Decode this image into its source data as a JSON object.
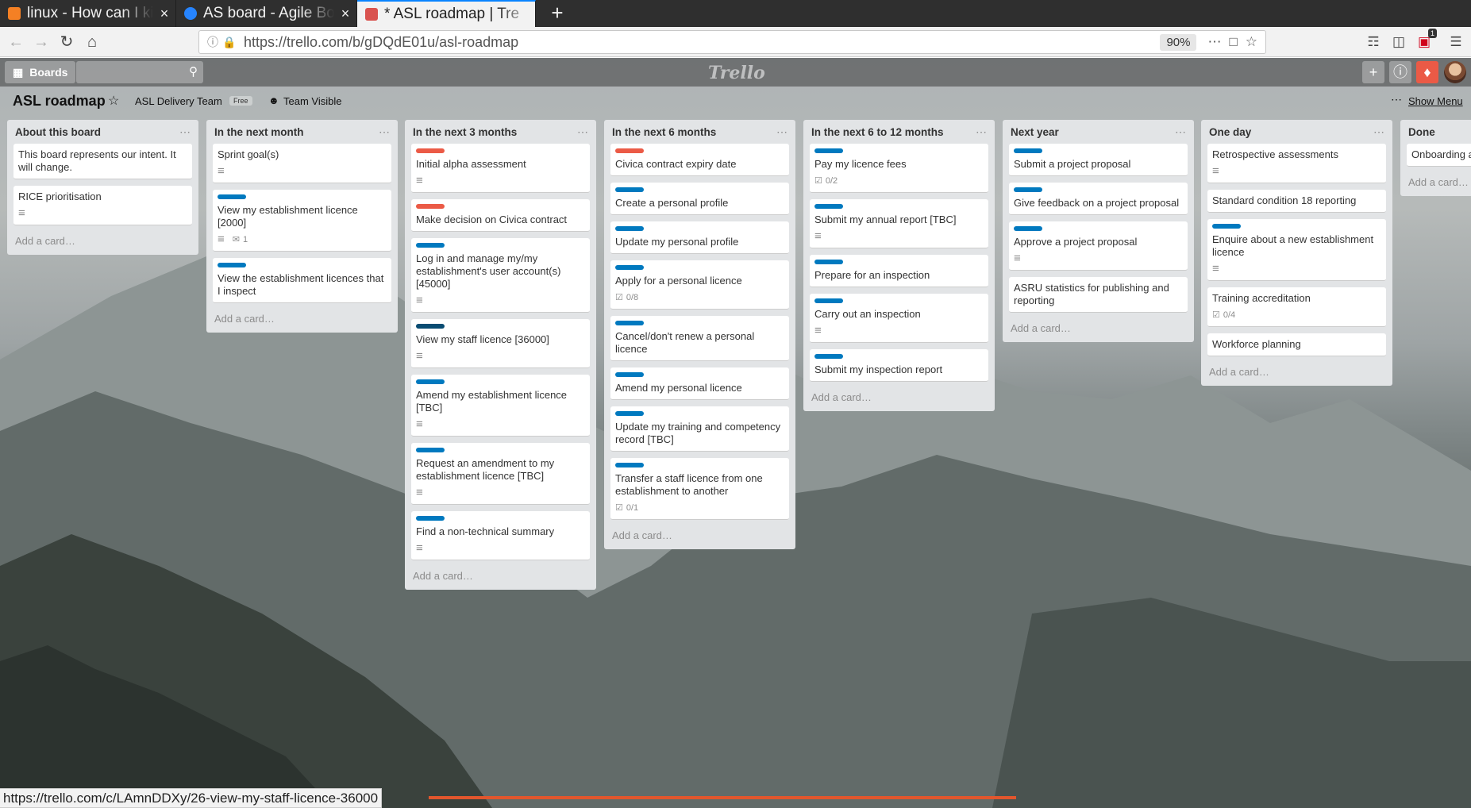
{
  "browser": {
    "tabs": [
      {
        "label": "linux - How can I kill",
        "favicon": "stackoverflow-icon",
        "active": false
      },
      {
        "label": "AS board - Agile Bo",
        "favicon": "jira-icon",
        "active": false
      },
      {
        "label": "* ASL roadmap | Tre",
        "favicon": "trello-icon",
        "active": true
      }
    ],
    "new_tab": "+",
    "close": "×",
    "url": "https://trello.com/b/gDQdE01u/asl-roadmap",
    "zoom": "90%",
    "notification_count": "1"
  },
  "trello": {
    "boards_label": "Boards",
    "logo": "Trello",
    "board_title": "ASL roadmap",
    "team_name": "ASL Delivery Team",
    "team_plan": "Free",
    "visibility": "Team Visible",
    "show_menu": "Show Menu",
    "add_card": "Add a card…",
    "lists": [
      {
        "title": "About this board",
        "cards": [
          {
            "title": "This board represents our intent. It will change.",
            "desc": false
          },
          {
            "title": "RICE prioritisation",
            "desc": true
          }
        ]
      },
      {
        "title": "In the next month",
        "cards": [
          {
            "title": "Sprint goal(s)",
            "desc": true
          },
          {
            "title": "View my establishment licence [2000]",
            "label": "#0079bf",
            "desc": true,
            "comments": "1"
          },
          {
            "title": "View the establishment licences that I inspect",
            "label": "#0079bf"
          }
        ]
      },
      {
        "title": "In the next 3 months",
        "cards": [
          {
            "title": "Initial alpha assessment",
            "label": "#eb5a46",
            "desc": true
          },
          {
            "title": "Make decision on Civica contract",
            "label": "#eb5a46"
          },
          {
            "title": "Log in and manage my/my establishment's user account(s) [45000]",
            "label": "#0079bf",
            "desc": true
          },
          {
            "title": "View my staff licence [36000]",
            "label": "#094c72",
            "desc": true
          },
          {
            "title": "Amend my establishment licence [TBC]",
            "label": "#0079bf",
            "desc": true
          },
          {
            "title": "Request an amendment to my establishment licence [TBC]",
            "label": "#0079bf",
            "desc": true
          },
          {
            "title": "Find a non-technical summary",
            "label": "#0079bf",
            "desc": true
          }
        ]
      },
      {
        "title": "In the next 6 months",
        "cards": [
          {
            "title": "Civica contract expiry date",
            "label": "#eb5a46"
          },
          {
            "title": "Create a personal profile",
            "label": "#0079bf"
          },
          {
            "title": "Update my personal profile",
            "label": "#0079bf"
          },
          {
            "title": "Apply for a personal licence",
            "label": "#0079bf",
            "checklist": "0/8"
          },
          {
            "title": "Cancel/don't renew a personal licence",
            "label": "#0079bf"
          },
          {
            "title": "Amend my personal licence",
            "label": "#0079bf"
          },
          {
            "title": "Update my training and competency record [TBC]",
            "label": "#0079bf"
          },
          {
            "title": "Transfer a staff licence from one establishment to another",
            "label": "#0079bf",
            "checklist": "0/1"
          }
        ]
      },
      {
        "title": "In the next 6 to 12 months",
        "cards": [
          {
            "title": "Pay my licence fees",
            "label": "#0079bf",
            "checklist": "0/2"
          },
          {
            "title": "Submit my annual report [TBC]",
            "label": "#0079bf",
            "desc": true
          },
          {
            "title": "Prepare for an inspection",
            "label": "#0079bf"
          },
          {
            "title": "Carry out an inspection",
            "label": "#0079bf",
            "desc": true
          },
          {
            "title": "Submit my inspection report",
            "label": "#0079bf"
          }
        ]
      },
      {
        "title": "Next year",
        "cards": [
          {
            "title": "Submit a project proposal",
            "label": "#0079bf"
          },
          {
            "title": "Give feedback on a project proposal",
            "label": "#0079bf"
          },
          {
            "title": "Approve a project proposal",
            "label": "#0079bf",
            "desc": true
          },
          {
            "title": "ASRU statistics for publishing and reporting"
          }
        ]
      },
      {
        "title": "One day",
        "cards": [
          {
            "title": "Retrospective assessments",
            "desc": true
          },
          {
            "title": "Standard condition 18 reporting"
          },
          {
            "title": "Enquire about a new establishment licence",
            "label": "#0079bf",
            "desc": true
          },
          {
            "title": "Training accreditation",
            "checklist": "0/4"
          },
          {
            "title": "Workforce planning"
          }
        ]
      },
      {
        "title": "Done",
        "cards": [
          {
            "title": "Onboarding a"
          }
        ]
      }
    ]
  },
  "status_url": "https://trello.com/c/LAmnDDXy/26-view-my-staff-licence-36000"
}
